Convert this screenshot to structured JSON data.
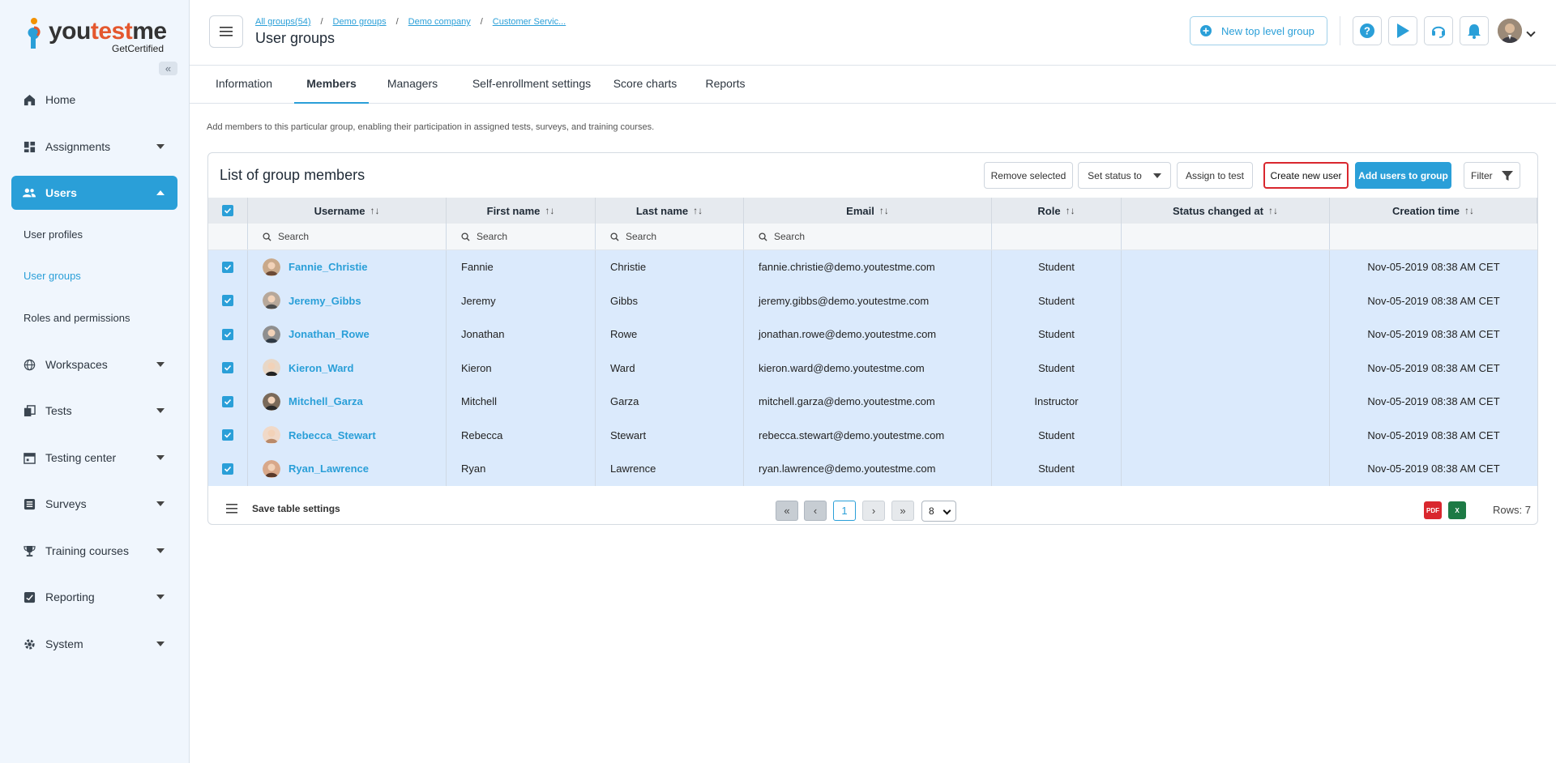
{
  "app": {
    "logo_text_a": "you",
    "logo_text_b": "test",
    "logo_text_c": "me",
    "logo_sub": "GetCertified"
  },
  "sidebar": {
    "items": [
      {
        "label": "Home",
        "icon": "home-icon"
      },
      {
        "label": "Assignments",
        "icon": "dashboard-icon"
      },
      {
        "label": "Users",
        "icon": "users-icon"
      },
      {
        "label": "Workspaces",
        "icon": "globe-icon"
      },
      {
        "label": "Tests",
        "icon": "copy-icon"
      },
      {
        "label": "Testing center",
        "icon": "calendar-icon"
      },
      {
        "label": "Surveys",
        "icon": "list-icon"
      },
      {
        "label": "Training courses",
        "icon": "trophy-icon"
      },
      {
        "label": "Reporting",
        "icon": "report-icon"
      },
      {
        "label": "System",
        "icon": "gear-icon"
      }
    ],
    "users_sub": [
      "User profiles",
      "User groups",
      "Roles and permissions"
    ]
  },
  "header": {
    "breadcrumbs": [
      "All groups(54)",
      "Demo groups",
      "Demo company",
      "Customer Servic..."
    ],
    "title": "User groups",
    "new_group_label": "New top level group"
  },
  "tabs": [
    "Information",
    "Members",
    "Managers",
    "Self-enrollment settings",
    "Score charts",
    "Reports"
  ],
  "main": {
    "description": "Add members to this particular group, enabling their participation in assigned tests, surveys, and training courses."
  },
  "card": {
    "title": "List of group members",
    "remove_selected": "Remove selected",
    "set_status": "Set status to",
    "assign_test": "Assign to test",
    "create_user": "Create new user",
    "add_users": "Add users to group",
    "filter": "Filter"
  },
  "table": {
    "columns": [
      "Username",
      "First name",
      "Last name",
      "Email",
      "Role",
      "Status changed at",
      "Creation time"
    ],
    "search_placeholder": "Search",
    "rows": [
      {
        "username": "Fannie_Christie",
        "first": "Fannie",
        "last": "Christie",
        "email": "fannie.christie@demo.youtestme.com",
        "role": "Student",
        "status_changed": "",
        "created": "Nov-05-2019 08:38 AM CET"
      },
      {
        "username": "Jeremy_Gibbs",
        "first": "Jeremy",
        "last": "Gibbs",
        "email": "jeremy.gibbs@demo.youtestme.com",
        "role": "Student",
        "status_changed": "",
        "created": "Nov-05-2019 08:38 AM CET"
      },
      {
        "username": "Jonathan_Rowe",
        "first": "Jonathan",
        "last": "Rowe",
        "email": "jonathan.rowe@demo.youtestme.com",
        "role": "Student",
        "status_changed": "",
        "created": "Nov-05-2019 08:38 AM CET"
      },
      {
        "username": "Kieron_Ward",
        "first": "Kieron",
        "last": "Ward",
        "email": "kieron.ward@demo.youtestme.com",
        "role": "Student",
        "status_changed": "",
        "created": "Nov-05-2019 08:38 AM CET"
      },
      {
        "username": "Mitchell_Garza",
        "first": "Mitchell",
        "last": "Garza",
        "email": "mitchell.garza@demo.youtestme.com",
        "role": "Instructor",
        "status_changed": "",
        "created": "Nov-05-2019 08:38 AM CET"
      },
      {
        "username": "Rebecca_Stewart",
        "first": "Rebecca",
        "last": "Stewart",
        "email": "rebecca.stewart@demo.youtestme.com",
        "role": "Student",
        "status_changed": "",
        "created": "Nov-05-2019 08:38 AM CET"
      },
      {
        "username": "Ryan_Lawrence",
        "first": "Ryan",
        "last": "Lawrence",
        "email": "ryan.lawrence@demo.youtestme.com",
        "role": "Student",
        "status_changed": "",
        "created": "Nov-05-2019 08:38 AM CET"
      }
    ]
  },
  "footer": {
    "save_settings": "Save table settings",
    "current_page": "1",
    "page_size": "8",
    "rows_label": "Rows: 7"
  },
  "colors": {
    "accent": "#2a9fd8",
    "highlight_border": "#d9272e",
    "row_selected": "#dbeafc"
  }
}
